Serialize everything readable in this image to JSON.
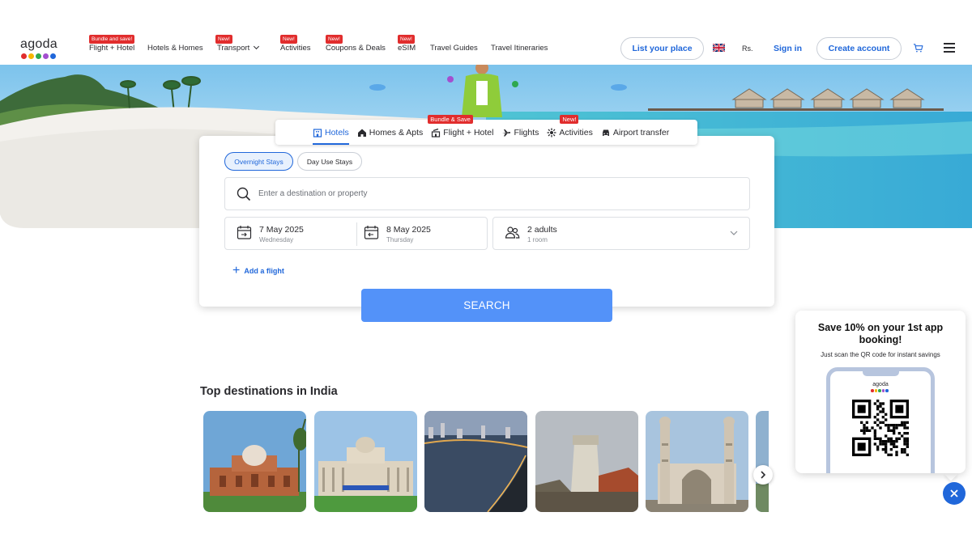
{
  "logo": {
    "text": "agoda",
    "dot_colors": [
      "#e12d2d",
      "#f7b500",
      "#2fa84f",
      "#a34fcf",
      "#2067da"
    ]
  },
  "nav": {
    "items": [
      {
        "label": "Flight + Hotel",
        "badge": "Bundle and save!"
      },
      {
        "label": "Hotels & Homes",
        "badge": ""
      },
      {
        "label": "Transport",
        "badge": "New!",
        "dropdown": true
      },
      {
        "label": "Activities",
        "badge": "New!"
      },
      {
        "label": "Coupons & Deals",
        "badge": "New!"
      },
      {
        "label": "eSIM",
        "badge": "New!"
      },
      {
        "label": "Travel Guides",
        "badge": ""
      },
      {
        "label": "Travel Itineraries",
        "badge": ""
      }
    ],
    "list_place": "List your place",
    "currency": "Rs.",
    "sign_in": "Sign in",
    "create_account": "Create account",
    "flag_icon": "uk-flag-icon",
    "cart_icon": "cart-icon",
    "menu_icon": "hamburger-menu-icon"
  },
  "tabs": [
    {
      "label": "Hotels",
      "icon": "hotel-icon",
      "active": true,
      "badge": ""
    },
    {
      "label": "Homes & Apts",
      "icon": "home-icon",
      "active": false,
      "badge": ""
    },
    {
      "label": "Flight + Hotel",
      "icon": "flight-hotel-icon",
      "active": false,
      "badge": "Bundle & Save"
    },
    {
      "label": "Flights",
      "icon": "plane-icon",
      "active": false,
      "badge": ""
    },
    {
      "label": "Activities",
      "icon": "activities-icon",
      "active": false,
      "badge": "New!"
    },
    {
      "label": "Airport transfer",
      "icon": "car-icon",
      "active": false,
      "badge": ""
    }
  ],
  "search": {
    "overnight": "Overnight Stays",
    "day_use": "Day Use Stays",
    "destination_placeholder": "Enter a destination or property",
    "checkin_date": "7 May 2025",
    "checkin_day": "Wednesday",
    "checkout_date": "8 May 2025",
    "checkout_day": "Thursday",
    "adults": "2 adults",
    "rooms": "1 room",
    "add_flight": "Add a flight",
    "button": "SEARCH"
  },
  "destinations": {
    "title": "Top destinations in India",
    "cards": [
      {
        "name": "humayun-tomb",
        "sky": "#6fa6d6"
      },
      {
        "name": "vidhana-soudha",
        "sky": "#9cc3e6"
      },
      {
        "name": "marine-drive",
        "sky": "#586b85"
      },
      {
        "name": "aguada-fort",
        "sky": "#b7bcc2"
      },
      {
        "name": "charminar",
        "sky": "#a8c4de"
      }
    ]
  },
  "promo": {
    "title": "Save 10% on your 1st app booking!",
    "subtitle": "Just scan the QR code for instant savings",
    "phone_logo": "agoda"
  },
  "colors": {
    "accent": "#2067da",
    "search_button": "#5392f9",
    "badge": "#e12d2d"
  }
}
